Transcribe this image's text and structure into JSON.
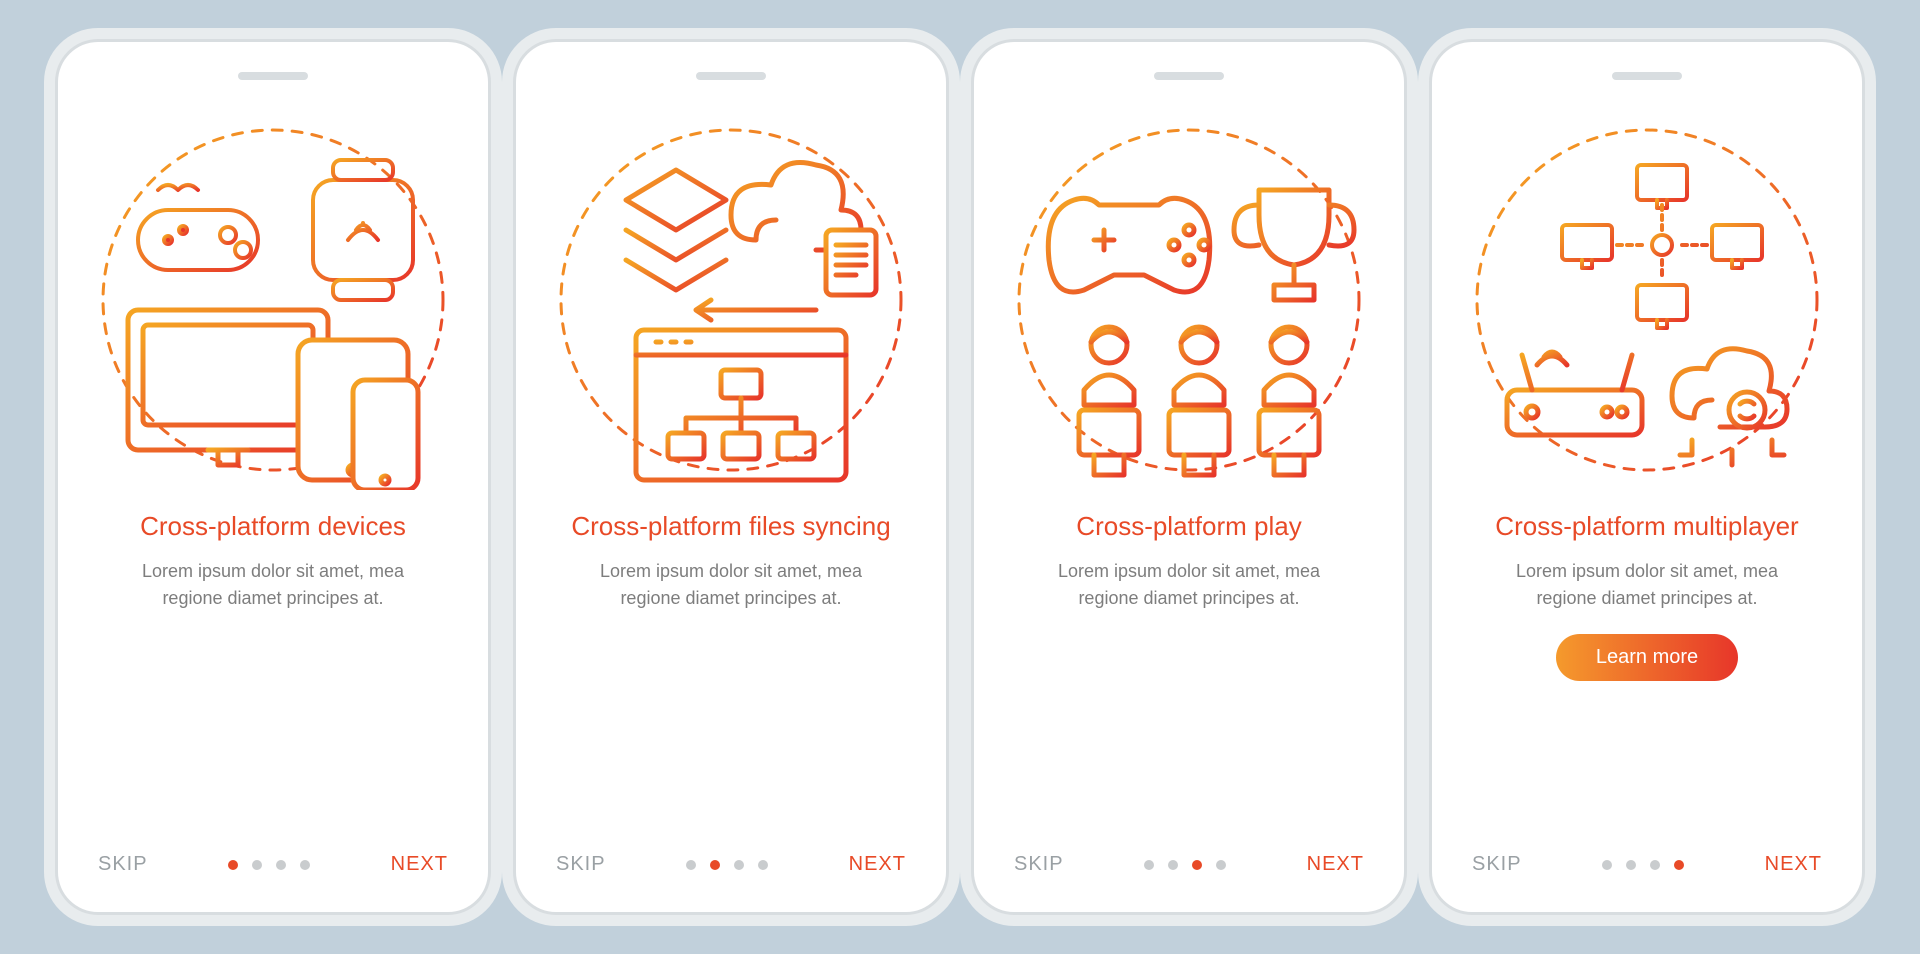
{
  "common": {
    "skip_label": "SKIP",
    "next_label": "NEXT",
    "desc": "Lorem ipsum dolor sit amet, mea regione diamet principes at."
  },
  "screens": [
    {
      "title": "Cross-platform devices",
      "active_dot": 0,
      "learn_more": null
    },
    {
      "title": "Cross-platform files syncing",
      "active_dot": 1,
      "learn_more": null
    },
    {
      "title": "Cross-platform play",
      "active_dot": 2,
      "learn_more": null
    },
    {
      "title": "Cross-platform multiplayer",
      "active_dot": 3,
      "learn_more": "Learn more"
    }
  ]
}
